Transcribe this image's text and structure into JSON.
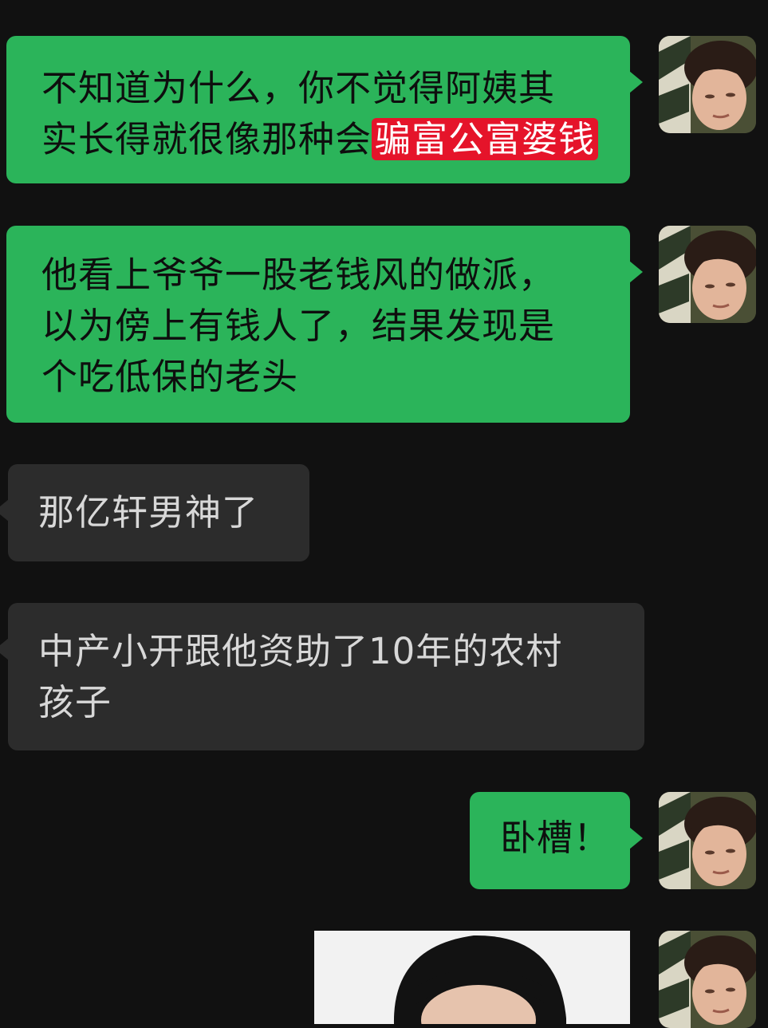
{
  "messages": [
    {
      "side": "out",
      "line1": "不知道为什么，你不觉得阿姨其",
      "line2_plain": "实长得就很像那种会",
      "line2_highlight": "骗富公富婆钱"
    },
    {
      "side": "out",
      "lines": [
        "他看上爷爷一股老钱风的做派，",
        "以为傍上有钱人了，结果发现是",
        "个吃低保的老头"
      ]
    },
    {
      "side": "in",
      "lines": [
        "那亿轩男神了"
      ]
    },
    {
      "side": "in",
      "lines": [
        "中产小开跟他资助了10年的农村",
        "孩子"
      ]
    },
    {
      "side": "out",
      "lines": [
        "卧槽！"
      ]
    }
  ],
  "colors": {
    "background": "#111111",
    "outgoing_bubble": "#2bb45a",
    "incoming_bubble": "#2c2c2c",
    "highlight": "#e5142a"
  },
  "icons": {
    "avatar": "user-avatar-photo",
    "image_message": "photo-thumbnail"
  }
}
